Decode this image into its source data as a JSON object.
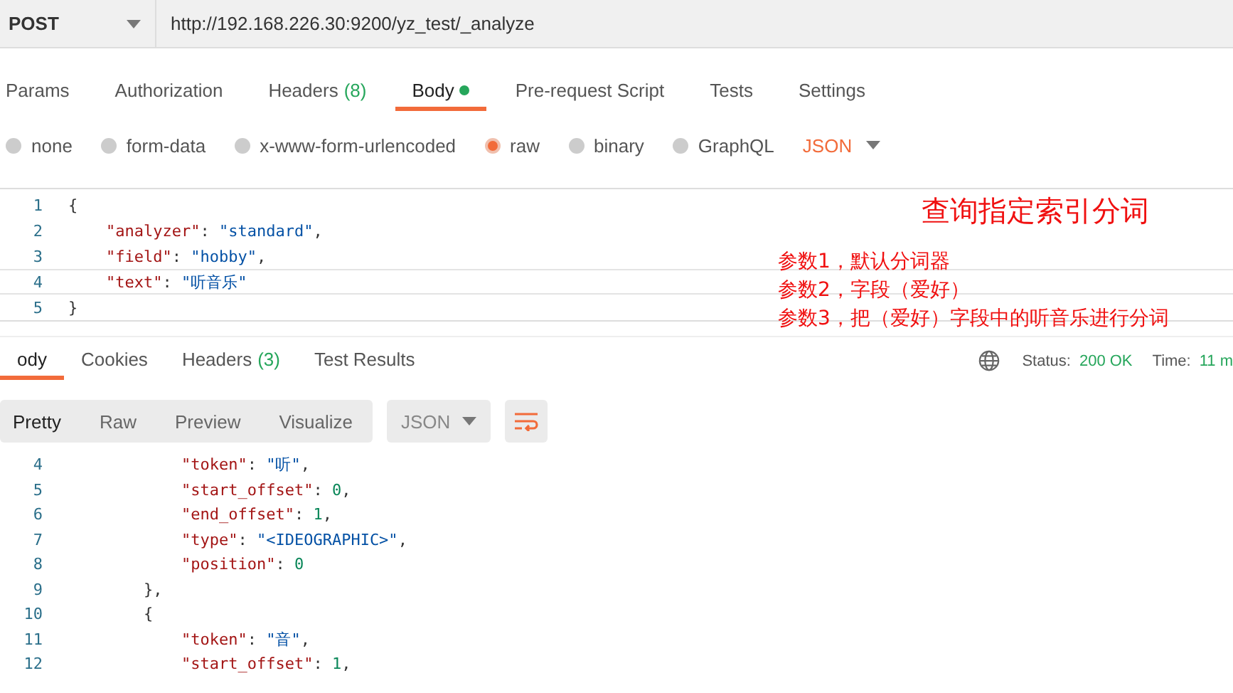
{
  "request": {
    "method": "POST",
    "url": "http://192.168.226.30:9200/yz_test/_analyze"
  },
  "request_tabs": [
    {
      "label": "Params",
      "selected": false
    },
    {
      "label": "Authorization",
      "selected": false
    },
    {
      "label": "Headers",
      "count": "(8)",
      "selected": false
    },
    {
      "label": "Body",
      "selected": true,
      "has_content": true
    },
    {
      "label": "Pre-request Script",
      "selected": false
    },
    {
      "label": "Tests",
      "selected": false
    },
    {
      "label": "Settings",
      "selected": false
    }
  ],
  "body_types": [
    {
      "label": "none",
      "selected": false
    },
    {
      "label": "form-data",
      "selected": false
    },
    {
      "label": "x-www-form-urlencoded",
      "selected": false
    },
    {
      "label": "raw",
      "selected": true
    },
    {
      "label": "binary",
      "selected": false
    },
    {
      "label": "GraphQL",
      "selected": false
    }
  ],
  "body_format": "JSON",
  "request_body": [
    {
      "number": "1",
      "current": false,
      "tokens": [
        {
          "kind": "punct",
          "text": "{"
        }
      ]
    },
    {
      "number": "2",
      "current": false,
      "tokens": [
        {
          "kind": "key",
          "text": "    \"analyzer\""
        },
        {
          "kind": "punct",
          "text": ": "
        },
        {
          "kind": "string",
          "text": "\"standard\""
        },
        {
          "kind": "punct",
          "text": ","
        }
      ]
    },
    {
      "number": "3",
      "current": false,
      "tokens": [
        {
          "kind": "key",
          "text": "    \"field\""
        },
        {
          "kind": "punct",
          "text": ": "
        },
        {
          "kind": "string",
          "text": "\"hobby\""
        },
        {
          "kind": "punct",
          "text": ","
        }
      ]
    },
    {
      "number": "4",
      "current": true,
      "tokens": [
        {
          "kind": "key",
          "text": "    \"text\""
        },
        {
          "kind": "punct",
          "text": ": "
        },
        {
          "kind": "string",
          "text": "\"听音乐\""
        }
      ]
    },
    {
      "number": "5",
      "current": false,
      "tokens": [
        {
          "kind": "punct",
          "text": "}"
        }
      ]
    }
  ],
  "annotations": {
    "title": "查询指定索引分词",
    "notes": [
      "参数1，默认分词器",
      "参数2，字段（爱好）",
      "参数3，把（爱好）字段中的听音乐进行分词"
    ]
  },
  "response_tabs": [
    {
      "label": "ody",
      "selected": true
    },
    {
      "label": "Cookies",
      "selected": false
    },
    {
      "label": "Headers",
      "count": "(3)",
      "selected": false
    },
    {
      "label": "Test Results",
      "selected": false
    }
  ],
  "status": {
    "label": "Status:",
    "value": "200 OK"
  },
  "time": {
    "label": "Time:",
    "value": "11 m"
  },
  "view_modes": [
    {
      "label": "Pretty",
      "selected": true
    },
    {
      "label": "Raw",
      "selected": false
    },
    {
      "label": "Preview",
      "selected": false
    },
    {
      "label": "Visualize",
      "selected": false
    }
  ],
  "response_format": "JSON",
  "response_body": [
    {
      "number": "4",
      "tokens": [
        {
          "kind": "key",
          "text": "            \"token\""
        },
        {
          "kind": "punct",
          "text": ": "
        },
        {
          "kind": "string",
          "text": "\"听\""
        },
        {
          "kind": "punct",
          "text": ","
        }
      ]
    },
    {
      "number": "5",
      "tokens": [
        {
          "kind": "key",
          "text": "            \"start_offset\""
        },
        {
          "kind": "punct",
          "text": ": "
        },
        {
          "kind": "number",
          "text": "0"
        },
        {
          "kind": "punct",
          "text": ","
        }
      ]
    },
    {
      "number": "6",
      "tokens": [
        {
          "kind": "key",
          "text": "            \"end_offset\""
        },
        {
          "kind": "punct",
          "text": ": "
        },
        {
          "kind": "number",
          "text": "1"
        },
        {
          "kind": "punct",
          "text": ","
        }
      ]
    },
    {
      "number": "7",
      "tokens": [
        {
          "kind": "key",
          "text": "            \"type\""
        },
        {
          "kind": "punct",
          "text": ": "
        },
        {
          "kind": "string",
          "text": "\"<IDEOGRAPHIC>\""
        },
        {
          "kind": "punct",
          "text": ","
        }
      ]
    },
    {
      "number": "8",
      "tokens": [
        {
          "kind": "key",
          "text": "            \"position\""
        },
        {
          "kind": "punct",
          "text": ": "
        },
        {
          "kind": "number",
          "text": "0"
        }
      ]
    },
    {
      "number": "9",
      "tokens": [
        {
          "kind": "punct",
          "text": "        },"
        }
      ]
    },
    {
      "number": "10",
      "tokens": [
        {
          "kind": "punct",
          "text": "        {"
        }
      ]
    },
    {
      "number": "11",
      "tokens": [
        {
          "kind": "key",
          "text": "            \"token\""
        },
        {
          "kind": "punct",
          "text": ": "
        },
        {
          "kind": "string",
          "text": "\"音\""
        },
        {
          "kind": "punct",
          "text": ","
        }
      ]
    },
    {
      "number": "12",
      "tokens": [
        {
          "kind": "key",
          "text": "            \"start_offset\""
        },
        {
          "kind": "punct",
          "text": ": "
        },
        {
          "kind": "number",
          "text": "1"
        },
        {
          "kind": "punct",
          "text": ","
        }
      ]
    }
  ]
}
